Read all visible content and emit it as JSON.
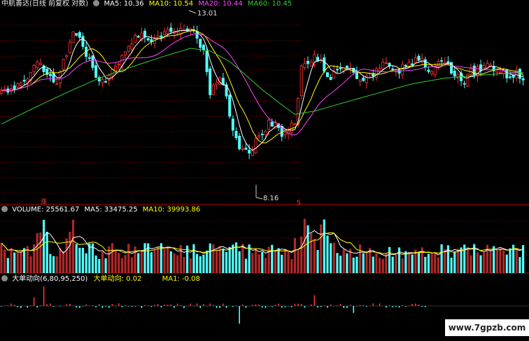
{
  "header": {
    "title": "中航善达(日线 前复权 对数)",
    "ma_items": [
      {
        "label": "MA5: 10.36",
        "color": "#ffffff"
      },
      {
        "label": "MA10: 10.54",
        "color": "#ffff00"
      },
      {
        "label": "MA20: 10.44",
        "color": "#ff44ff"
      },
      {
        "label": "MA60: 10.45",
        "color": "#33cc33"
      }
    ]
  },
  "volume_header": {
    "title": "VOLUME: 25561.67",
    "ma5": "MA5: 33475.25",
    "ma10": "MA10: 39993.86"
  },
  "indicator_header": {
    "title": "大单动向(6,80,95,250)",
    "value": "大单动向: 0.02",
    "ma1": "MA1: -0.08"
  },
  "annotations": {
    "high": "13.01",
    "low": "8.16",
    "zhang_marker": "涨",
    "s_marker": "S"
  },
  "watermark": "www.7gpzb.com",
  "colors": {
    "up": "#ff3232",
    "down": "#54ffff",
    "ma5": "#ffffff",
    "ma10": "#ffff00",
    "ma20": "#ff44ff",
    "ma60": "#33cc33",
    "grid": "#8b0000"
  },
  "chart_data": [
    {
      "type": "candlestick",
      "title": "中航善达(日线 前复权 对数)",
      "price_range": [
        8.16,
        13.01
      ],
      "annotated_high": 13.01,
      "annotated_low": 8.16,
      "latest_ma": {
        "MA5": 10.36,
        "MA10": 10.54,
        "MA20": 10.44,
        "MA60": 10.45
      },
      "close_path": [
        [
          0,
          10.2
        ],
        [
          4,
          10.4
        ],
        [
          8,
          10.8
        ],
        [
          10,
          11.2
        ],
        [
          12,
          11.3
        ],
        [
          14,
          10.8
        ],
        [
          17,
          10.6
        ],
        [
          20,
          11.6
        ],
        [
          22,
          12.3
        ],
        [
          24,
          12.1
        ],
        [
          26,
          11.6
        ],
        [
          29,
          10.8
        ],
        [
          31,
          10.6
        ],
        [
          34,
          10.9
        ],
        [
          37,
          11.5
        ],
        [
          39,
          11.9
        ],
        [
          41,
          12.4
        ],
        [
          44,
          12.3
        ],
        [
          47,
          12.1
        ],
        [
          50,
          12.4
        ],
        [
          53,
          12.6
        ],
        [
          56,
          12.5
        ],
        [
          58,
          12.6
        ],
        [
          60,
          12.3
        ],
        [
          62,
          11.6
        ],
        [
          63,
          10.8
        ],
        [
          64,
          10.2
        ],
        [
          65,
          10.4
        ],
        [
          67,
          10.8
        ],
        [
          69,
          10.1
        ],
        [
          71,
          9.0
        ],
        [
          73,
          8.5
        ],
        [
          75,
          8.4
        ],
        [
          77,
          8.5
        ],
        [
          79,
          8.9
        ],
        [
          82,
          9.2
        ],
        [
          84,
          9.3
        ],
        [
          86,
          8.9
        ],
        [
          88,
          9.0
        ],
        [
          90,
          9.3
        ],
        [
          92,
          11.0
        ],
        [
          94,
          11.3
        ],
        [
          96,
          11.4
        ],
        [
          98,
          11.3
        ],
        [
          100,
          10.6
        ],
        [
          102,
          10.8
        ],
        [
          105,
          11.2
        ],
        [
          108,
          10.9
        ],
        [
          110,
          10.5
        ],
        [
          113,
          10.8
        ],
        [
          116,
          11.1
        ],
        [
          119,
          11.2
        ],
        [
          122,
          11.0
        ],
        [
          125,
          11.2
        ],
        [
          128,
          11.4
        ],
        [
          131,
          11.0
        ],
        [
          134,
          11.2
        ],
        [
          137,
          11.1
        ],
        [
          140,
          10.8
        ],
        [
          142,
          10.6
        ],
        [
          144,
          10.9
        ],
        [
          147,
          11.0
        ],
        [
          150,
          11.2
        ],
        [
          152,
          11.0
        ],
        [
          154,
          10.9
        ],
        [
          156,
          10.7
        ],
        [
          158,
          10.9
        ],
        [
          160,
          10.5
        ]
      ],
      "ma60_path": [
        [
          0,
          9.2
        ],
        [
          10,
          9.7
        ],
        [
          20,
          10.2
        ],
        [
          30,
          10.7
        ],
        [
          40,
          11.1
        ],
        [
          50,
          11.5
        ],
        [
          58,
          11.8
        ],
        [
          64,
          11.7
        ],
        [
          70,
          11.3
        ],
        [
          80,
          10.3
        ],
        [
          86,
          9.8
        ],
        [
          90,
          9.5
        ],
        [
          96,
          9.6
        ],
        [
          106,
          9.9
        ],
        [
          116,
          10.2
        ],
        [
          126,
          10.5
        ],
        [
          136,
          10.7
        ],
        [
          146,
          10.8
        ],
        [
          160,
          10.9
        ]
      ]
    },
    {
      "type": "bar",
      "title": "VOLUME",
      "latest": {
        "VOLUME": 25561.67,
        "MA5": 33475.25,
        "MA10": 39993.86
      }
    },
    {
      "type": "bar",
      "title": "大单动向(6,80,95,250)",
      "latest": {
        "大单动向": 0.02,
        "MA1": -0.08
      }
    }
  ]
}
